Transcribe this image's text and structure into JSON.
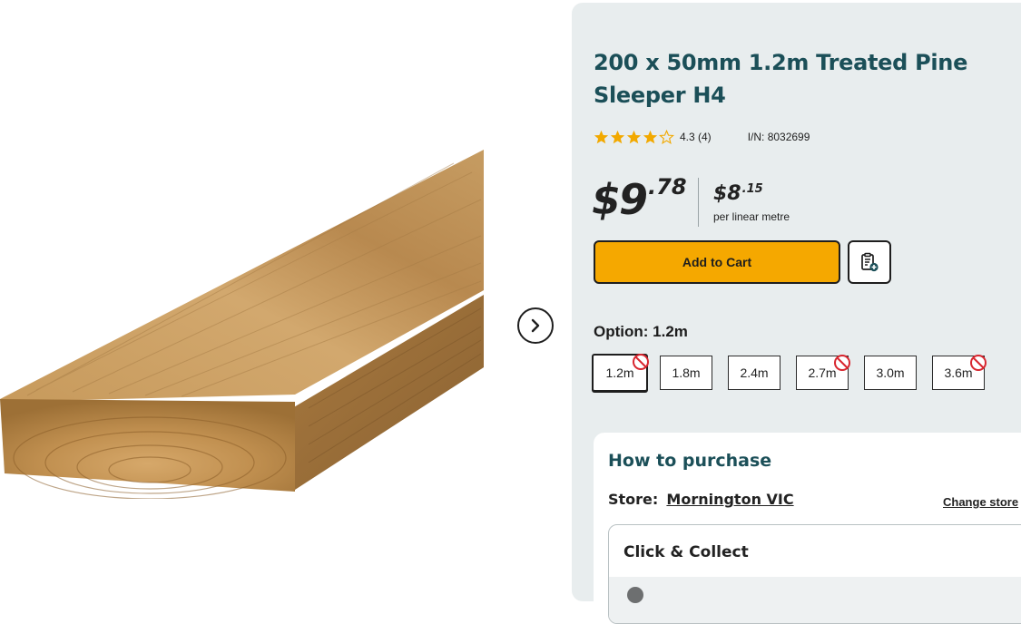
{
  "product": {
    "title": "200 x 50mm 1.2m Treated Pine Sleeper H4",
    "rating_value": 4.3,
    "rating_text": "4.3 (4)",
    "item_number": "I/N: 8032699"
  },
  "price": {
    "dollars": "$9",
    "cents": ".78",
    "unit_dollars": "$8",
    "unit_cents": ".15",
    "unit_label": "per linear metre"
  },
  "actions": {
    "add_to_cart": "Add to Cart"
  },
  "options": {
    "label": "Option: 1.2m",
    "items": [
      {
        "label": "1.2m",
        "selected": true,
        "unavailable": true
      },
      {
        "label": "1.8m",
        "selected": false,
        "unavailable": false
      },
      {
        "label": "2.4m",
        "selected": false,
        "unavailable": false
      },
      {
        "label": "2.7m",
        "selected": false,
        "unavailable": true
      },
      {
        "label": "3.0m",
        "selected": false,
        "unavailable": false
      },
      {
        "label": "3.6m",
        "selected": false,
        "unavailable": true
      }
    ]
  },
  "purchase": {
    "title": "How to purchase",
    "store_label": "Store:",
    "store_name": "Mornington VIC",
    "change_store": "Change store",
    "click_collect": "Click & Collect"
  },
  "colors": {
    "accent_yellow": "#f5a800",
    "heading_teal": "#1b4f58",
    "star_gold": "#f2a900",
    "unavailable_red": "#d8262f",
    "panel_bg": "#e8edee"
  },
  "icons": {
    "next": "chevron-right-icon",
    "list": "clipboard-add-icon",
    "unavailable": "no-entry-icon",
    "star": "star-icon"
  }
}
